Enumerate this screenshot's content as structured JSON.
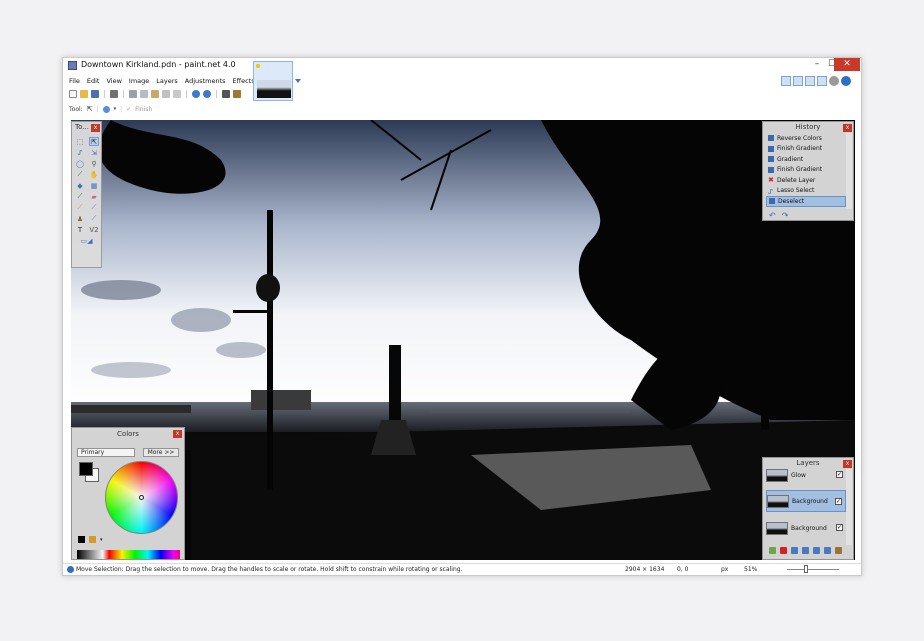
{
  "window": {
    "title": "Downtown Kirkland.pdn - paint.net 4.0",
    "min_label": "–",
    "max_label": "☐",
    "close_label": "✕"
  },
  "menu": {
    "items": [
      "File",
      "Edit",
      "View",
      "Image",
      "Layers",
      "Adjustments",
      "Effects"
    ]
  },
  "toolrow": {
    "tool_label": "Tool:",
    "finish_label": "Finish"
  },
  "tools_panel": {
    "title": "To...",
    "close": "x",
    "text_tool": "T",
    "shapes_tool": "V2"
  },
  "history": {
    "title": "History",
    "close": "x",
    "items": [
      {
        "label": "Reverse Colors",
        "icon": "history-step-icon"
      },
      {
        "label": "Finish Gradient",
        "icon": "history-step-icon"
      },
      {
        "label": "Gradient",
        "icon": "history-step-icon"
      },
      {
        "label": "Finish Gradient",
        "icon": "history-step-icon"
      },
      {
        "label": "Delete Layer",
        "icon": "delete-icon"
      },
      {
        "label": "Lasso Select",
        "icon": "lasso-icon"
      },
      {
        "label": "Deselect",
        "icon": "history-step-icon",
        "selected": true
      }
    ],
    "undo": "↶",
    "redo": "↷"
  },
  "colors": {
    "title": "Colors",
    "close": "x",
    "mode_selected": "Primary",
    "more_label": "More >>",
    "primary_color": "#000000",
    "secondary_color": "#ffffff"
  },
  "layers": {
    "title": "Layers",
    "close": "x",
    "items": [
      {
        "name": "Glow",
        "visible": true
      },
      {
        "name": "Background",
        "visible": true,
        "selected": true
      },
      {
        "name": "Background",
        "visible": true
      }
    ]
  },
  "status": {
    "message": "Move Selection: Drag the selection to move. Drag the handles to scale or rotate. Hold shift to constrain while rotating or scaling.",
    "image_size": "2904 × 1634",
    "cursor_pos": "0, 0",
    "unit": "px",
    "zoom": "51%"
  },
  "colors_accent": {
    "selection": "#a9c6ea",
    "close_button": "#c9392a"
  }
}
